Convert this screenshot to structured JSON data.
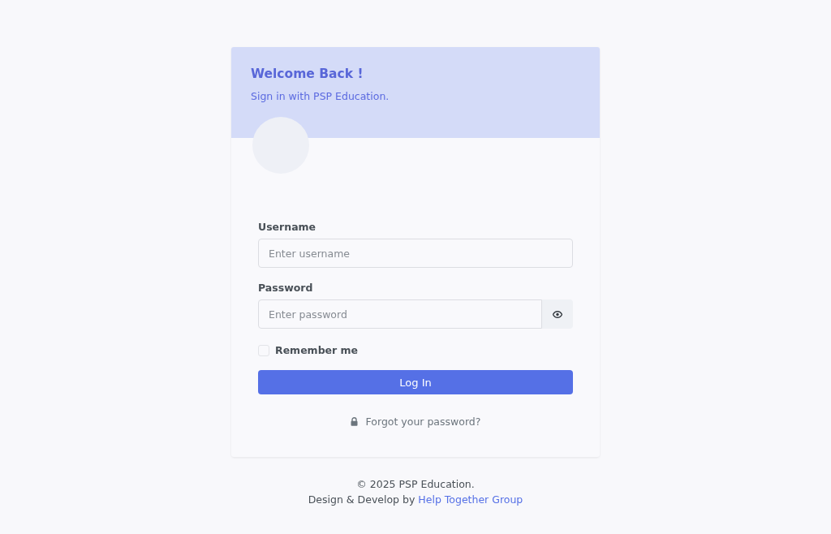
{
  "header": {
    "title": "Welcome Back !",
    "subtitle": "Sign in with PSP Education."
  },
  "form": {
    "username": {
      "label": "Username",
      "placeholder": "Enter username"
    },
    "password": {
      "label": "Password",
      "placeholder": "Enter password"
    },
    "remember": {
      "label": "Remember me",
      "checked": false
    },
    "submit": "Log In",
    "forgot": "Forgot your password?"
  },
  "footer": {
    "copyright": "© 2025 PSP Education.",
    "credit": "Design & Develop by",
    "credit_link": "Help Together Group"
  }
}
